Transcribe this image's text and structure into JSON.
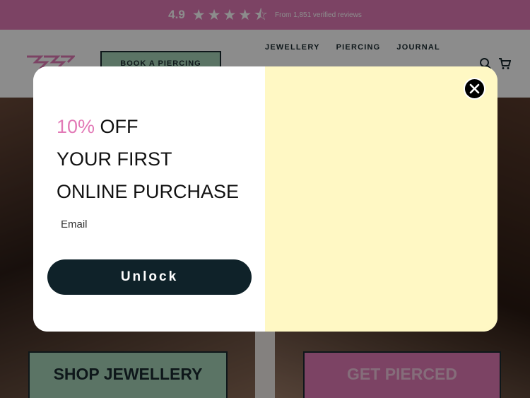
{
  "topbar": {
    "rating": "4.9",
    "stars": [
      "★",
      "★",
      "★",
      "★",
      "⯪"
    ],
    "reviews": "From 1,851 verified reviews"
  },
  "header": {
    "book_button": "BOOK A PIERCING",
    "nav": [
      "JEWELLERY",
      "PIERCING",
      "JOURNAL"
    ]
  },
  "hero": {
    "shop_button": "SHOP JEWELLERY",
    "pierce_button": "GET PIERCED"
  },
  "modal": {
    "headline_percent": "10%",
    "headline_off": " OFF",
    "headline_line2": "YOUR FIRST",
    "headline_line3": "ONLINE PURCHASE",
    "email_placeholder": "Email",
    "unlock_button": "Unlock"
  },
  "colors": {
    "brand_pink": "#e27ab7",
    "mint": "#a7d3b8",
    "dark": "#0f2229",
    "cream": "#fff8c4"
  },
  "icons": [
    "logo-icon",
    "search-icon",
    "cart-icon",
    "close-icon",
    "star-icon"
  ]
}
